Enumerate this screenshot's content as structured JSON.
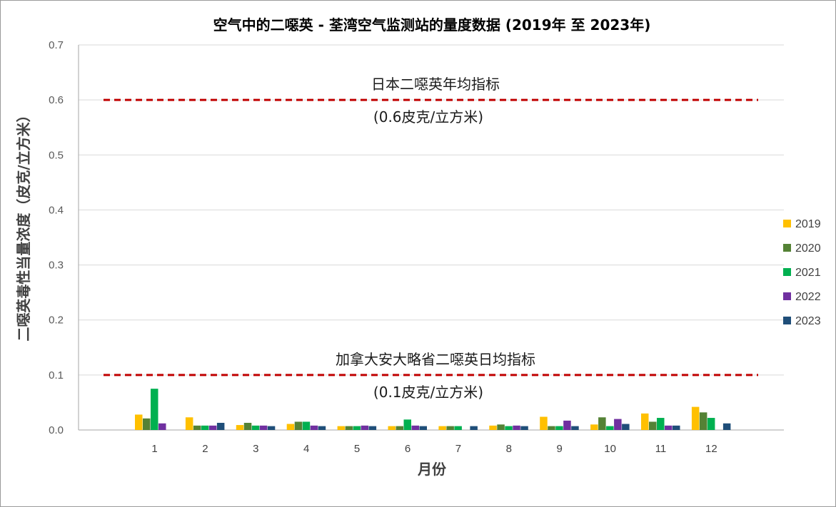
{
  "chart_data": {
    "type": "bar",
    "title": "空气中的二噁英 - 荃湾空气监测站的量度数据 (2019年 至 2023年)",
    "xlabel": "月份",
    "ylabel": "二噁英毒性当量浓度（皮克/立方米）",
    "ylim": [
      0,
      0.7
    ],
    "yticks": [
      "0.0",
      "0.1",
      "0.2",
      "0.3",
      "0.4",
      "0.5",
      "0.6",
      "0.7"
    ],
    "grid": true,
    "legend_position": "right",
    "categories": [
      "1",
      "2",
      "3",
      "4",
      "5",
      "6",
      "7",
      "8",
      "9",
      "10",
      "11",
      "12"
    ],
    "series": [
      {
        "name": "2019",
        "color": "#FFC000",
        "values": [
          0.028,
          0.023,
          0.009,
          0.011,
          0.007,
          0.007,
          0.007,
          0.008,
          0.024,
          0.01,
          0.03,
          0.042
        ]
      },
      {
        "name": "2020",
        "color": "#548235",
        "values": [
          0.021,
          0.008,
          0.013,
          0.015,
          0.007,
          0.007,
          0.007,
          0.01,
          0.007,
          0.023,
          0.015,
          0.032
        ]
      },
      {
        "name": "2021",
        "color": "#00B050",
        "values": [
          0.075,
          0.008,
          0.008,
          0.015,
          0.007,
          0.019,
          0.007,
          0.007,
          0.007,
          0.007,
          0.022,
          0.022
        ]
      },
      {
        "name": "2022",
        "color": "#7030A0",
        "values": [
          0.012,
          0.008,
          0.008,
          0.008,
          0.008,
          0.008,
          null,
          0.008,
          0.017,
          0.02,
          0.008,
          null
        ]
      },
      {
        "name": "2023",
        "color": "#1F4E79",
        "values": [
          null,
          0.013,
          0.007,
          0.007,
          0.007,
          0.007,
          0.007,
          0.007,
          0.007,
          0.011,
          0.008,
          0.012
        ]
      }
    ],
    "reference_lines": [
      {
        "value": 0.6,
        "color": "#C00000",
        "label": "日本二噁英年均指标",
        "sublabel": "(0.6皮克/立方米)"
      },
      {
        "value": 0.1,
        "color": "#C00000",
        "label": "加拿大安大略省二噁英日均指标",
        "sublabel": "(0.1皮克/立方米)"
      }
    ]
  }
}
